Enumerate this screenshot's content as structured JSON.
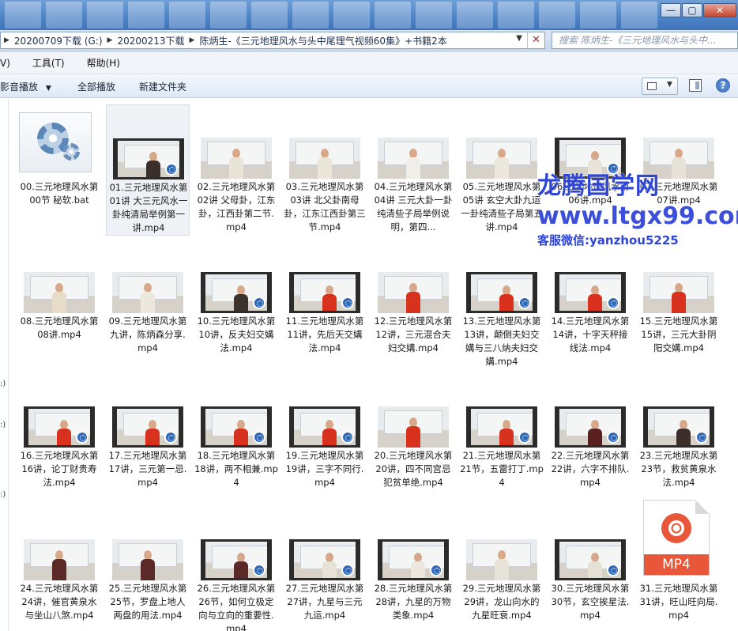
{
  "window": {
    "btn_min": "—",
    "btn_max": "▢",
    "btn_close": "✕"
  },
  "address": {
    "segments": [
      "20200709下载 (G:)",
      "20200213下载",
      "陈炳生-《三元地理风水与头中尾理气视频60集》+书籍2本"
    ],
    "search_placeholder": "搜索 陈炳生-《三元地理风水与头中..."
  },
  "menu": {
    "view": "V)",
    "tools": "工具(T)",
    "help": "帮助(H)"
  },
  "toolbar": {
    "play": "影音播放",
    "play_all": "全部播放",
    "new_folder": "新建文件夹",
    "help_glyph": "?"
  },
  "leftnav": {
    "marks": [
      ":)",
      ":)",
      ":)"
    ]
  },
  "watermark": {
    "line1": "龙腾国学网",
    "line2": "www.ltgx99.com",
    "line3": "客服微信:yanzhou5225"
  },
  "files": [
    {
      "name": "00.三元地理风水第00节 秘软.bat",
      "kind": "bat"
    },
    {
      "name": "01.三元地理风水第01讲 大三元风水一卦纯清局举例第一讲.mp4",
      "kind": "film",
      "shirt": "#3a2f2a",
      "selected": true
    },
    {
      "name": "02.三元地理风水第02讲 父母卦，江东卦，江西卦第二节.mp4",
      "kind": "plain",
      "shirt": "#e8e4d8"
    },
    {
      "name": "03.三元地理风水第03讲 北父卦南母卦，江东江西卦第三节.mp4",
      "kind": "plain",
      "shirt": "#eae6da"
    },
    {
      "name": "04.三元地理风水第04讲 三元大卦一卦纯清些子局举例说明，第四...",
      "kind": "plain",
      "shirt": "#f0eee8"
    },
    {
      "name": "05.三元地理风水第05讲 玄空大卦九运一卦纯清些子局第五讲.mp4",
      "kind": "plain",
      "shirt": "#ebe7dc"
    },
    {
      "name": "06.三元地理风水第06讲.mp4",
      "kind": "film",
      "shirt": "#e9e4da"
    },
    {
      "name": "07.三元地理风水第07讲.mp4",
      "kind": "plain",
      "shirt": "#e7e2d7"
    },
    {
      "name": "08.三元地理风水第08讲.mp4",
      "kind": "plain",
      "shirt": "#e6dcc8"
    },
    {
      "name": "09.三元地理风水第九讲，陈炳森分享.mp4",
      "kind": "plain",
      "shirt": "#ece8dd"
    },
    {
      "name": "10.三元地理风水第10讲，反夫妇交媾法.mp4",
      "kind": "film",
      "shirt": "#3c332d"
    },
    {
      "name": "11.三元地理风水第11讲，先后天交媾法.mp4",
      "kind": "film",
      "shirt": "#d8311e"
    },
    {
      "name": "12.三元地理风水第12讲，三元混合夫妇交媾.mp4",
      "kind": "plain",
      "shirt": "#d8311e"
    },
    {
      "name": "13.三元地理风水第13讲，颠倒夫妇交媾与三八纳夫妇交媾.mp4",
      "kind": "film",
      "shirt": "#d8311e"
    },
    {
      "name": "14.三元地理风水第14讲，十字天秤接线法.mp4",
      "kind": "film",
      "shirt": "#d8311e"
    },
    {
      "name": "15.三元地理风水第15讲，三元大卦阴阳交媾.mp4",
      "kind": "plain",
      "shirt": "#d8311e"
    },
    {
      "name": "16.三元地理风水第16讲，论丁财贵寿法.mp4",
      "kind": "film",
      "shirt": "#d8311e"
    },
    {
      "name": "17.三元地理风水第17讲，三元第一忌.mp4",
      "kind": "film",
      "shirt": "#d8311e"
    },
    {
      "name": "18.三元地理风水第18讲，两不相兼.mp4",
      "kind": "film",
      "shirt": "#d8311e"
    },
    {
      "name": "19.三元地理风水第19讲，三字不同行.mp4",
      "kind": "film",
      "shirt": "#d8311e"
    },
    {
      "name": "20.三元地理风水第20讲，四不同宫忌犯贫单绝.mp4",
      "kind": "plain",
      "shirt": "#d8311e"
    },
    {
      "name": "21.三元地理风水第21节，五雷打丁.mp4",
      "kind": "film",
      "shirt": "#d8311e"
    },
    {
      "name": "22.三元地理风水第22讲，六字不排队.mp4",
      "kind": "film",
      "shirt": "#5a1f1f"
    },
    {
      "name": "23.三元地理风水第23节，救贫黄泉水法.mp4",
      "kind": "film",
      "shirt": "#3c2e2a"
    },
    {
      "name": "24.三元地理风水第24讲，催官黄泉水与坐山八煞.mp4",
      "kind": "plain",
      "shirt": "#5b2a28"
    },
    {
      "name": "25.三元地理风水第25节，罗盘上地人两盘的用法.mp4",
      "kind": "plain",
      "shirt": "#5b2a28"
    },
    {
      "name": "26.三元地理风水第26节，如何立极定向与立向的重要性.mp4",
      "kind": "film",
      "shirt": "#5b2a28"
    },
    {
      "name": "27.三元地理风水第27讲，九星与三元九运.mp4",
      "kind": "film",
      "shirt": "#e7e3d9"
    },
    {
      "name": "28.三元地理风水第28讲，九星的万物类象.mp4",
      "kind": "film",
      "shirt": "#ece8df"
    },
    {
      "name": "29.三元地理风水第29讲，龙山向水的九星旺衰.mp4",
      "kind": "plain",
      "shirt": "#e7e3d9"
    },
    {
      "name": "30.三元地理风水第30节，玄空挨星法.mp4",
      "kind": "film",
      "shirt": "#e5e1d6"
    },
    {
      "name": "31.三元地理风水第31讲，旺山旺向局.mp4",
      "kind": "mp4icon",
      "tag": "MP4"
    }
  ]
}
